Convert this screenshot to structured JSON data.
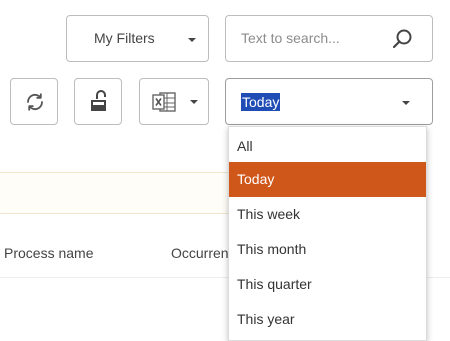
{
  "filters": {
    "label": "My Filters"
  },
  "search": {
    "placeholder": "Text to search..."
  },
  "toolbar": {
    "refresh_icon": "refresh-icon",
    "lock_icon": "unlock-icon",
    "excel_icon": "excel-icon"
  },
  "period": {
    "selected": "Today",
    "options": [
      "All",
      "Today",
      "This week",
      "This month",
      "This quarter",
      "This year"
    ],
    "selected_index": 1
  },
  "table": {
    "columns": [
      "Process name",
      "Occurrences"
    ]
  },
  "colors": {
    "accent": "#d0571a",
    "selection_highlight": "#1f4db5"
  }
}
